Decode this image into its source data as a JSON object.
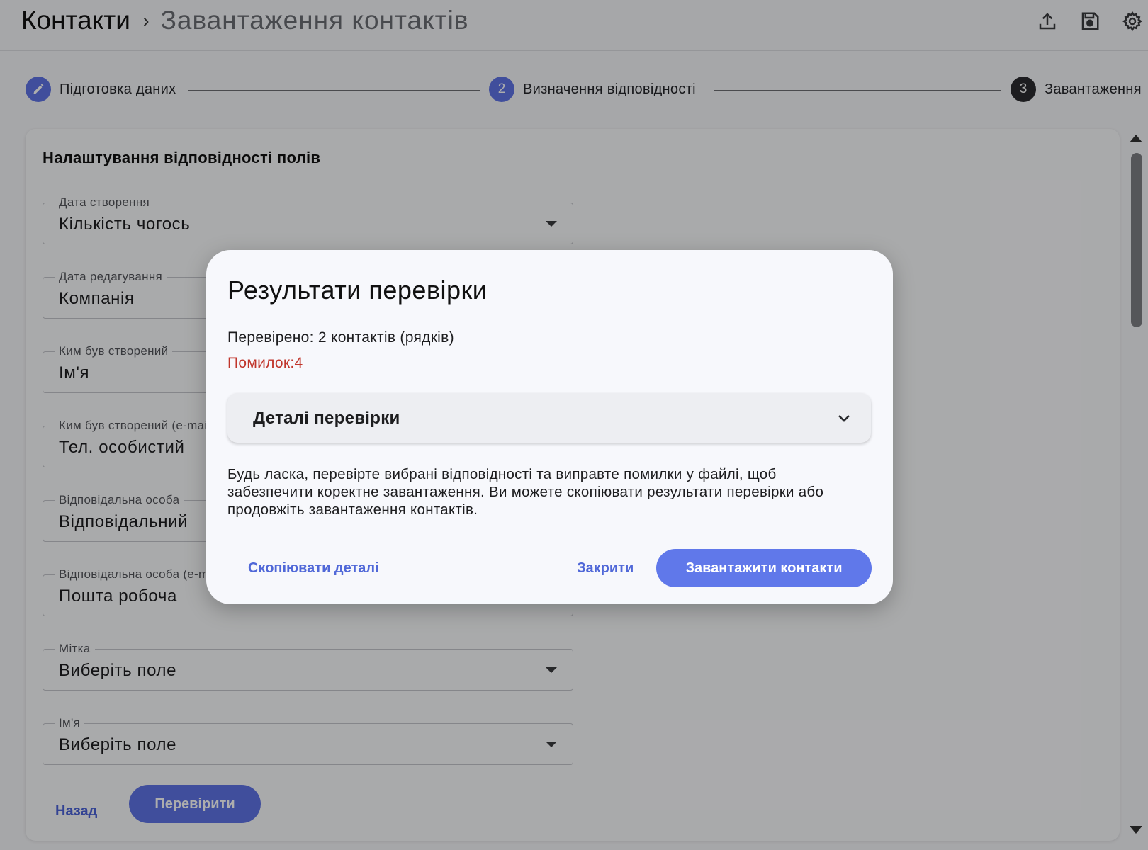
{
  "header": {
    "breadcrumb_root": "Контакти",
    "breadcrumb_separator": "›",
    "breadcrumb_current": "Завантаження контактів",
    "icons": [
      "upload-icon",
      "save-icon",
      "settings-icon"
    ]
  },
  "stepper": {
    "steps": [
      {
        "marker": "✎",
        "label": "Підготовка даних",
        "state": "done"
      },
      {
        "marker": "2",
        "label": "Визначення відповідності",
        "state": "active"
      },
      {
        "marker": "3",
        "label": "Завантаження",
        "state": "pending"
      }
    ]
  },
  "form": {
    "title": "Налаштування відповідності полів",
    "fields": [
      {
        "label": "Дата створення",
        "value": "Кількість чогось"
      },
      {
        "label": "Дата редагування",
        "value": "Компанія"
      },
      {
        "label": "Ким був створений",
        "value": "Ім'я"
      },
      {
        "label": "Ким був створений (e-mail)",
        "value": "Тел. особистий"
      },
      {
        "label": "Відповідальна особа",
        "value": "Відповідальний"
      },
      {
        "label": "Відповідальна особа (e-mail)",
        "value": "Пошта робоча"
      },
      {
        "label": "Мітка",
        "value": "Виберіть поле"
      },
      {
        "label": "Ім'я",
        "value": "Виберіть поле"
      }
    ],
    "back_label": "Назад",
    "check_label": "Перевірити"
  },
  "dialog": {
    "title": "Результати перевірки",
    "checked_text": "Перевірено: 2 контактів (рядків)",
    "errors_text": "Помилок:4",
    "details_label": "Деталі перевірки",
    "message": "Будь ласка, перевірте вибрані відповідності та виправте помилки у файлі, щоб забезпечити коректне завантаження. Ви можете скопіювати результати перевірки або продовжіть завантаження контактів.",
    "copy_label": "Скопіювати деталі",
    "close_label": "Закрити",
    "upload_label": "Завантажити контакти"
  },
  "colors": {
    "accent": "#5f74e6",
    "error": "#c0352b",
    "step_pending": "#2b2c30"
  }
}
